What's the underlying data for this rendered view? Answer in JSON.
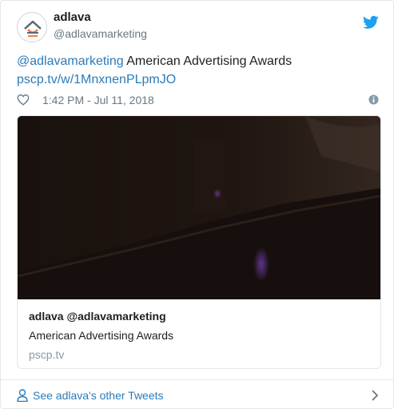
{
  "author": {
    "display_name": "adlava",
    "handle": "@adlavamarketing",
    "avatar_icon": "adlava-logo-icon",
    "brand_color": "#f47b48"
  },
  "twitter_icon": "twitter-bird-icon",
  "tweet": {
    "mention": "@adlavamarketing",
    "text": " American Advertising Awards",
    "url": "pscp.tv/w/1MnxnenPLpmJO"
  },
  "meta": {
    "like_icon": "heart-icon",
    "timestamp": "1:42 PM - Jul 11, 2018",
    "info_icon": "info-icon"
  },
  "card": {
    "author_name": "adlava",
    "author_handle": "@adlavamarketing",
    "description": "American Advertising Awards",
    "domain": "pscp.tv"
  },
  "footer": {
    "link_label": "See adlava's other Tweets",
    "person_icon": "person-icon",
    "chevron_icon": "chevron-right-icon"
  },
  "colors": {
    "link": "#2b7bb9",
    "text": "#1c2022",
    "muted": "#697882",
    "twitter_blue": "#1da1f2",
    "border": "#e1e8ed"
  }
}
